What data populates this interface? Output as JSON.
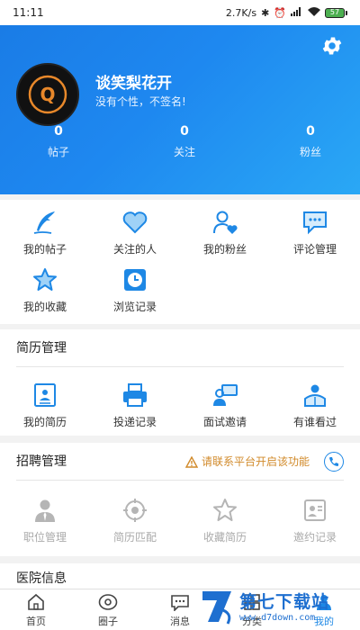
{
  "status_bar": {
    "time": "11:11",
    "net_speed": "2.7K/s",
    "battery": "57"
  },
  "profile": {
    "username": "谈笑梨花开",
    "signature": "没有个性，不签名!",
    "avatar_letter": "Q",
    "stats": [
      {
        "value": "0",
        "label": "帖子"
      },
      {
        "value": "0",
        "label": "关注"
      },
      {
        "value": "0",
        "label": "粉丝"
      }
    ]
  },
  "quick_menu": [
    {
      "label": "我的帖子",
      "icon": "quill-icon"
    },
    {
      "label": "关注的人",
      "icon": "heart-icon"
    },
    {
      "label": "我的粉丝",
      "icon": "person-heart-icon"
    },
    {
      "label": "评论管理",
      "icon": "comment-icon"
    },
    {
      "label": "我的收藏",
      "icon": "star-icon"
    },
    {
      "label": "浏览记录",
      "icon": "clock-icon"
    }
  ],
  "resume": {
    "title": "简历管理",
    "items": [
      {
        "label": "我的简历",
        "icon": "resume-icon"
      },
      {
        "label": "投递记录",
        "icon": "printer-icon"
      },
      {
        "label": "面试邀请",
        "icon": "interview-icon"
      },
      {
        "label": "有谁看过",
        "icon": "viewer-icon"
      }
    ]
  },
  "recruit": {
    "title": "招聘管理",
    "notice": "请联系平台开启该功能",
    "items": [
      {
        "label": "职位管理",
        "icon": "user-tie-icon"
      },
      {
        "label": "简历匹配",
        "icon": "target-icon"
      },
      {
        "label": "收藏简历",
        "icon": "star-outline-icon"
      },
      {
        "label": "邀约记录",
        "icon": "invite-icon"
      }
    ]
  },
  "hospital": {
    "title": "医院信息"
  },
  "bottom_nav": [
    {
      "label": "首页",
      "icon": "home-icon"
    },
    {
      "label": "圈子",
      "icon": "circle-icon"
    },
    {
      "label": "消息",
      "icon": "message-icon"
    },
    {
      "label": "分类",
      "icon": "category-icon"
    },
    {
      "label": "我的",
      "icon": "user-icon"
    }
  ],
  "watermark": {
    "title": "第七下载站",
    "url": "www.d7down.com"
  },
  "colors": {
    "header_start": "#1a7ce6",
    "header_end": "#2aa8f5",
    "icon_blue": "#1e88e5",
    "notice_orange": "#d18a2a",
    "disabled_gray": "#b5b5b5"
  }
}
